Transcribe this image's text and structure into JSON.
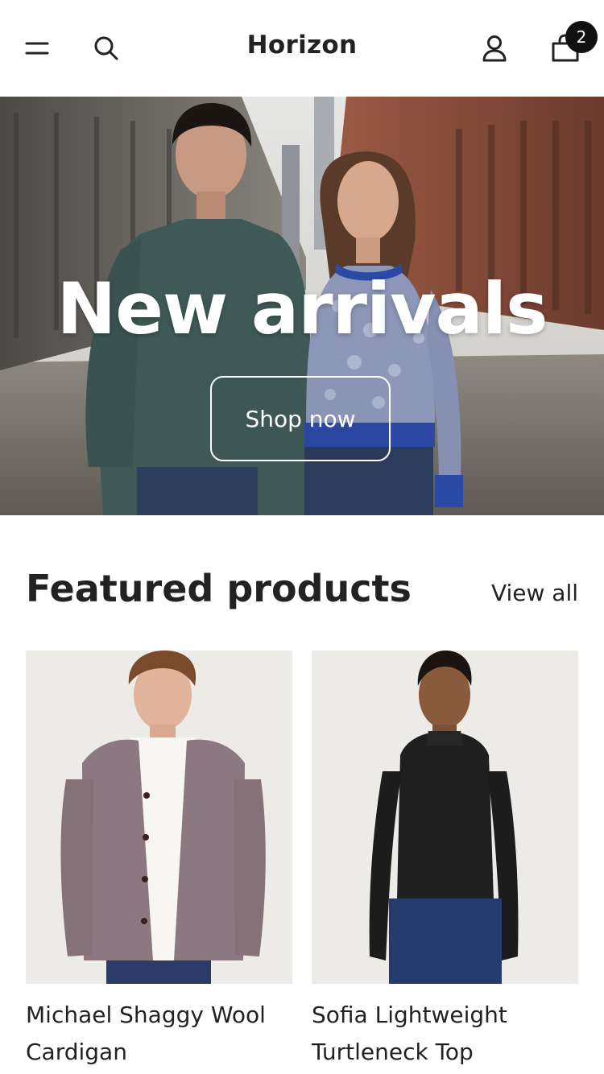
{
  "header": {
    "logo": "Horizon",
    "menu_icon": "menu-icon",
    "search_icon": "search-icon",
    "account_icon": "account-icon",
    "cart_icon": "cart-icon",
    "cart_count": "2"
  },
  "hero": {
    "title": "New arrivals",
    "button_label": "Shop now"
  },
  "featured": {
    "title": "Featured products",
    "view_all": "View all",
    "products": [
      {
        "name": "Michael Shaggy Wool Cardigan"
      },
      {
        "name": "Sofia Lightweight Turtleneck Top"
      }
    ]
  },
  "colors": {
    "text": "#222222",
    "badge": "#111111",
    "hero_text": "#ffffff"
  }
}
